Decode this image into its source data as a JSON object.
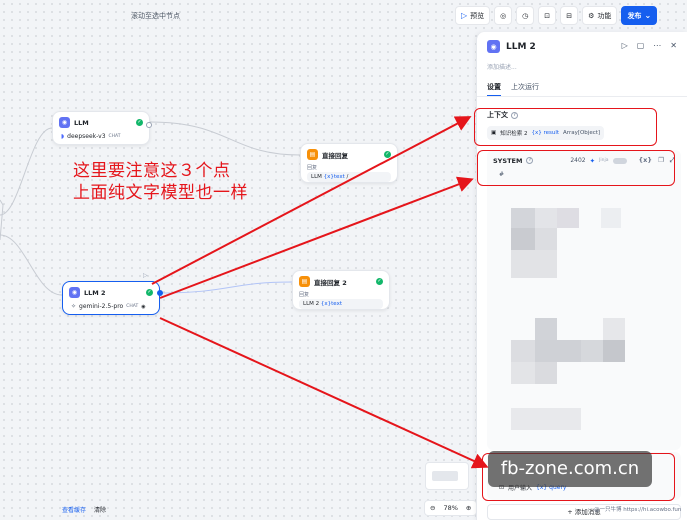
{
  "top": {
    "scroll_hint": "滚动至选中节点",
    "preview_label": "预览",
    "features_label": "功能",
    "publish_label": "发布"
  },
  "nodes": {
    "llm1": {
      "title": "LLM",
      "model": "deepseek-v3",
      "chip": "CHAT"
    },
    "reply1": {
      "title": "直接回复",
      "sub": "回复",
      "ref_node": "LLM",
      "ref_var": "{x}text",
      "ref_tail": "/"
    },
    "llm2": {
      "title": "LLM 2",
      "model": "gemini-2.5-pro",
      "chip": "CHAT"
    },
    "reply2": {
      "title": "直接回复 2",
      "sub": "回复",
      "ref_node": "LLM 2",
      "ref_var": "{x}text"
    }
  },
  "annotation": {
    "line1": "这里要注意这３个点",
    "line2": "上面纯文字模型也一样"
  },
  "panel": {
    "title": "LLM 2",
    "desc_placeholder": "添加描述...",
    "tabs": [
      "设置",
      "上次运行"
    ],
    "context": {
      "label": "上下文",
      "source": "知识检索 2",
      "var": "{x} result",
      "type": "Array[Object]"
    },
    "system": {
      "label": "SYSTEM",
      "count": "2402",
      "jinja": "Jinja",
      "first_line": "#"
    },
    "user": {
      "source": "用户输入",
      "var": "{x} query"
    },
    "add_message": "添加消息"
  },
  "watermark": {
    "text": "fb-zone.com.cn",
    "sub": "@一只牛博 https://hi.acowbo.fun"
  },
  "bottom": {
    "view_cache": "查看缓存",
    "clear": "清除",
    "zoom": "78%"
  },
  "colors": {
    "accent": "#155eef",
    "annotation_red": "#e5151b",
    "llm_icon": "#6172f3",
    "reply_icon": "#f79009",
    "success": "#12b76a"
  }
}
